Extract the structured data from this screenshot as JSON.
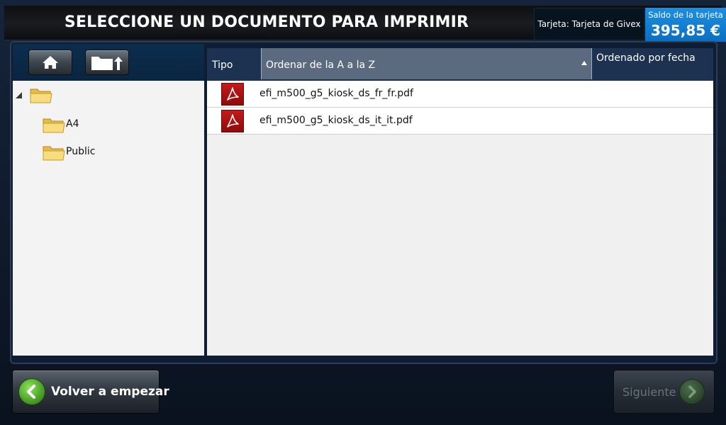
{
  "header": {
    "title": "SELECCIONE UN DOCUMENTO PARA IMPRIMIR",
    "card_text": "Tarjeta: Tarjeta de Givex",
    "balance_label": "Saldo de la tarjeta",
    "balance_value": "395,85 €"
  },
  "toolbar": {
    "home_icon": "home-icon",
    "up_icon": "folder-up-icon"
  },
  "tree": {
    "root_icon": "folder-icon",
    "items": [
      {
        "label": "A4",
        "icon": "folder-icon"
      },
      {
        "label": "Public",
        "icon": "folder-icon"
      }
    ]
  },
  "list": {
    "columns": {
      "tipo": "Tipo",
      "name": "Ordenar de la A a la Z",
      "date": "Ordenado por fecha"
    },
    "files": [
      {
        "name": "efi_m500_g5_kiosk_ds_fr_fr.pdf",
        "icon": "pdf-icon"
      },
      {
        "name": "efi_m500_g5_kiosk_ds_it_it.pdf",
        "icon": "pdf-icon"
      }
    ]
  },
  "footer": {
    "back_label": "Volver a empezar",
    "next_label": "Siguiente"
  },
  "colors": {
    "accent_blue": "#1c8fe3",
    "back_green": "#4ea52a",
    "pdf_red": "#c41a1a"
  }
}
